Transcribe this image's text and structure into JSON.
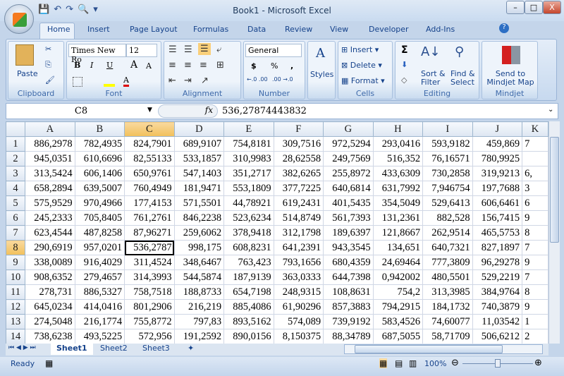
{
  "window": {
    "title": "Book1 - Microsoft Excel",
    "minimize": "–",
    "maximize": "□",
    "close": "X"
  },
  "qat": {
    "save": "💾",
    "undo": "↶",
    "redo": "↷",
    "preview": "🔍",
    "customize": "▾"
  },
  "tabs": [
    "Home",
    "Insert",
    "Page Layout",
    "Formulas",
    "Data",
    "Review",
    "View",
    "Developer",
    "Add-Ins"
  ],
  "ribbon": {
    "clipboard": {
      "label": "Clipboard",
      "paste": "Paste"
    },
    "font": {
      "label": "Font",
      "name": "Times New Ro",
      "size": "12",
      "bold": "B",
      "italic": "I",
      "underline": "U",
      "grow": "A",
      "shrink": "A",
      "color_letter": "A"
    },
    "alignment": {
      "label": "Alignment"
    },
    "number": {
      "label": "Number",
      "format": "General",
      "currency": "$",
      "percent": "%",
      "comma": ",",
      "inc": "←.0 .00",
      "dec": ".00 →.0"
    },
    "styles": {
      "label": "Styles"
    },
    "cells": {
      "label": "Cells",
      "insert": "Insert",
      "delete": "Delete",
      "format": "Format"
    },
    "editing": {
      "label": "Editing",
      "sum": "Σ",
      "sort": "Sort & Filter",
      "find": "Find & Select"
    },
    "mindjet": {
      "label": "Mindjet",
      "send": "Send to Mindjet Map"
    }
  },
  "formula_bar": {
    "name_box": "C8",
    "fx": "fx",
    "value": "536,27874443832"
  },
  "sheet": {
    "columns": [
      "A",
      "B",
      "C",
      "D",
      "E",
      "F",
      "G",
      "H",
      "I",
      "J",
      "K"
    ],
    "selected_col": "C",
    "selected_row": 8,
    "rows": [
      [
        "886,2978",
        "782,4935",
        "824,7901",
        "689,9107",
        "754,8181",
        "309,7516",
        "972,5294",
        "293,0416",
        "593,9182",
        "459,869",
        "7"
      ],
      [
        "945,0351",
        "610,6696",
        "82,55133",
        "533,1857",
        "310,9983",
        "28,62558",
        "249,7569",
        "516,352",
        "76,16571",
        "780,9925",
        ""
      ],
      [
        "313,5424",
        "606,1406",
        "650,9761",
        "547,1403",
        "351,2717",
        "382,6265",
        "255,8972",
        "433,6309",
        "730,2858",
        "319,9213",
        "6,"
      ],
      [
        "658,2894",
        "639,5007",
        "760,4949",
        "181,9471",
        "553,1809",
        "377,7225",
        "640,6814",
        "631,7992",
        "7,946754",
        "197,7688",
        "3"
      ],
      [
        "575,9529",
        "970,4966",
        "177,4153",
        "571,5501",
        "44,78921",
        "619,2431",
        "401,5435",
        "354,5049",
        "529,6413",
        "606,6461",
        "6"
      ],
      [
        "245,2333",
        "705,8405",
        "761,2761",
        "846,2238",
        "523,6234",
        "514,8749",
        "561,7393",
        "131,2361",
        "882,528",
        "156,7415",
        "9"
      ],
      [
        "623,4544",
        "487,8258",
        "87,96271",
        "259,6062",
        "378,9418",
        "312,1798",
        "189,6397",
        "121,8667",
        "262,9514",
        "465,5753",
        "8"
      ],
      [
        "290,6919",
        "957,0201",
        "536,2787",
        "998,175",
        "608,8231",
        "641,2391",
        "943,3545",
        "134,651",
        "640,7321",
        "827,1897",
        "7"
      ],
      [
        "338,0089",
        "916,4029",
        "311,4524",
        "348,6467",
        "763,423",
        "793,1656",
        "680,4359",
        "24,69464",
        "777,3809",
        "96,29278",
        "9"
      ],
      [
        "908,6352",
        "279,4657",
        "314,3993",
        "544,5874",
        "187,9139",
        "363,0333",
        "644,7398",
        "0,942002",
        "480,5501",
        "529,2219",
        "7"
      ],
      [
        "278,731",
        "886,5327",
        "758,7518",
        "188,8733",
        "654,7198",
        "248,9315",
        "108,8631",
        "754,2",
        "313,3985",
        "384,9764",
        "8"
      ],
      [
        "645,0234",
        "414,0416",
        "801,2906",
        "216,219",
        "885,4086",
        "61,90296",
        "857,3883",
        "794,2915",
        "184,1732",
        "740,3879",
        "9"
      ],
      [
        "274,5048",
        "216,1774",
        "755,8772",
        "797,83",
        "893,5162",
        "574,089",
        "739,9192",
        "583,4526",
        "74,60077",
        "11,03542",
        "1"
      ],
      [
        "738,6238",
        "493,5225",
        "572,956",
        "191,2592",
        "890,0156",
        "8,150375",
        "88,34789",
        "687,5055",
        "58,71709",
        "506,6212",
        "2"
      ]
    ]
  },
  "sheet_tabs": [
    "Sheet1",
    "Sheet2",
    "Sheet3"
  ],
  "status": {
    "text": "Ready",
    "zoom": "100%",
    "zoom_level": 100
  }
}
